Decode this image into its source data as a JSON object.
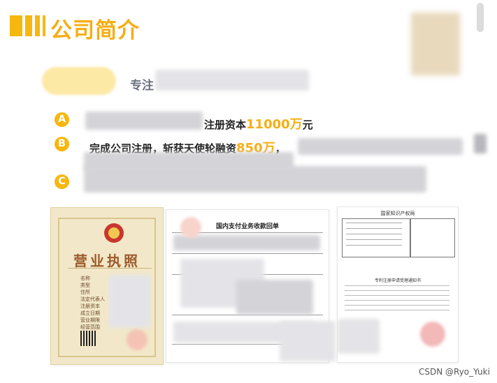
{
  "header": {
    "title": "公司简介"
  },
  "intro": {
    "tagline": "专注"
  },
  "bullets": [
    {
      "marker": "A",
      "text_before": "注册资本",
      "highlight": "11000万",
      "text_after": "元"
    },
    {
      "marker": "B",
      "text_before": "完成公司注册，斩获天使轮融资",
      "highlight": "850万",
      "text_after": "，"
    },
    {
      "marker": "C",
      "text_before": "",
      "highlight": "",
      "text_after": ""
    }
  ],
  "documents": {
    "license": {
      "title": "营业执照",
      "labels": [
        "名称",
        "类型",
        "住所",
        "法定代表人",
        "注册资本",
        "成立日期",
        "营业期限",
        "经营范围"
      ]
    },
    "receipt": {
      "title": "国内支付业务收款回单"
    },
    "patent": {
      "header": "国家知识产权局",
      "subtitle": "专利注册申请受理通知书"
    }
  },
  "footer": {
    "watermark": "CSDN @Ryo_Yuki"
  },
  "colors": {
    "accent": "#f6b70f",
    "highlight_text": "#f6ae14",
    "body_text": "#222222"
  }
}
